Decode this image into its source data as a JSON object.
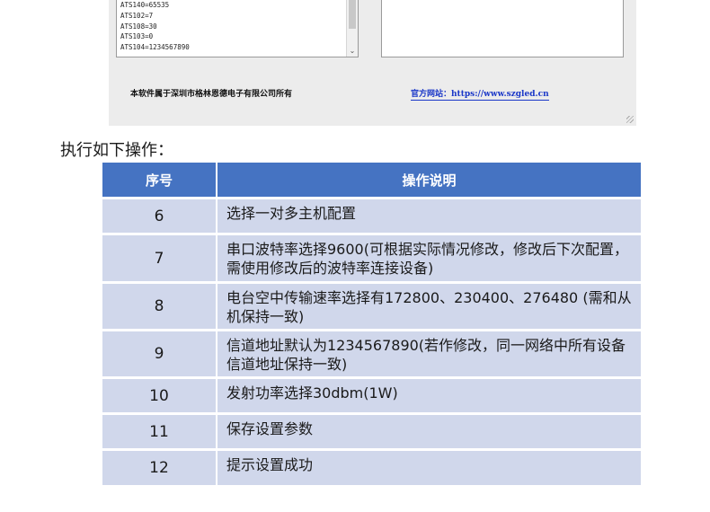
{
  "software": {
    "log_lines": [
      "ATS140=65535",
      "ATS102=7",
      "ATS108=30",
      "ATS103=0",
      "ATS104=1234567890"
    ],
    "scroll_down_glyph": "⌄",
    "copyright": "本软件属于深圳市格林恩德电子有限公司所有",
    "website": "官方网站：https://www.szgled.cn"
  },
  "intro": "执行如下操作：",
  "table": {
    "headers": [
      "序号",
      "操作说明"
    ],
    "rows": [
      {
        "num": "6",
        "desc": "选择一对多主机配置"
      },
      {
        "num": "7",
        "desc": "串口波特率选择9600(可根据实际情况修改，修改后下次配置，需使用修改后的波特率连接设备)"
      },
      {
        "num": "8",
        "desc": "电台空中传输速率选择有172800、230400、276480 (需和从机保持一致)"
      },
      {
        "num": "9",
        "desc": "信道地址默认为1234567890(若作修改，同一网络中所有设备信道地址保持一致)"
      },
      {
        "num": "10",
        "desc": "发射功率选择30dbm(1W)"
      },
      {
        "num": "11",
        "desc": "保存设置参数"
      },
      {
        "num": "12",
        "desc": "提示设置成功"
      }
    ]
  }
}
